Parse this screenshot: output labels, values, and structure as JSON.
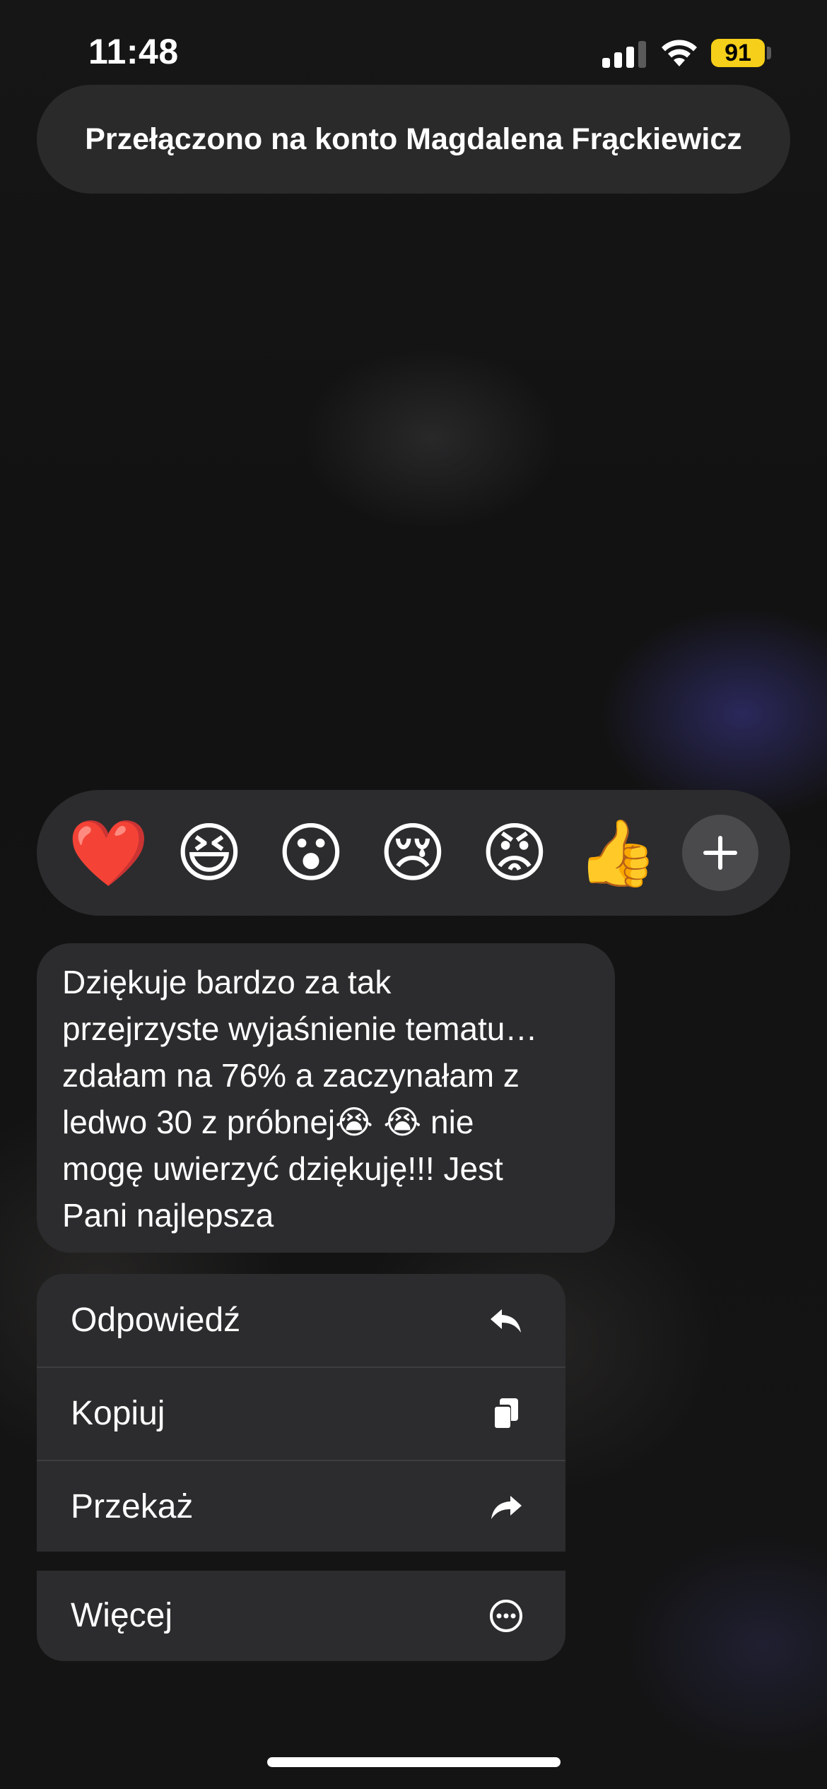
{
  "status_bar": {
    "time": "11:48",
    "battery_level": "91",
    "signal_bars_active": 3,
    "signal_bars_total": 4
  },
  "toast": {
    "text": "Przełączono na konto Magdalena Frąckiewicz"
  },
  "reactions": [
    {
      "emoji": "❤️",
      "name": "heart"
    },
    {
      "emoji": "😆",
      "name": "laughing"
    },
    {
      "emoji": "😮",
      "name": "surprised"
    },
    {
      "emoji": "😢",
      "name": "crying"
    },
    {
      "emoji": "😡",
      "name": "angry"
    },
    {
      "emoji": "👍",
      "name": "thumbs-up"
    },
    {
      "emoji": "+",
      "name": "add-reaction"
    }
  ],
  "message": {
    "line1": "Dziękuje bardzo za tak",
    "line2": "przejrzyste wyjaśnienie tematu…",
    "line3": "zdałam na 76% a zaczynałam z",
    "line4_pre": "ledwo 30 z próbnej",
    "line4_emoji": "😭 😭",
    "line4_post": " nie",
    "line5": "mogę uwierzyć dziękuję!!! Jest",
    "line6": "Pani najlepsza"
  },
  "menu": {
    "reply_label": "Odpowiedź",
    "copy_label": "Kopiuj",
    "forward_label": "Przekaż",
    "more_label": "Więcej"
  },
  "colors": {
    "battery": "#f5cf19",
    "surface": "#2c2c2e",
    "background": "#141414"
  }
}
